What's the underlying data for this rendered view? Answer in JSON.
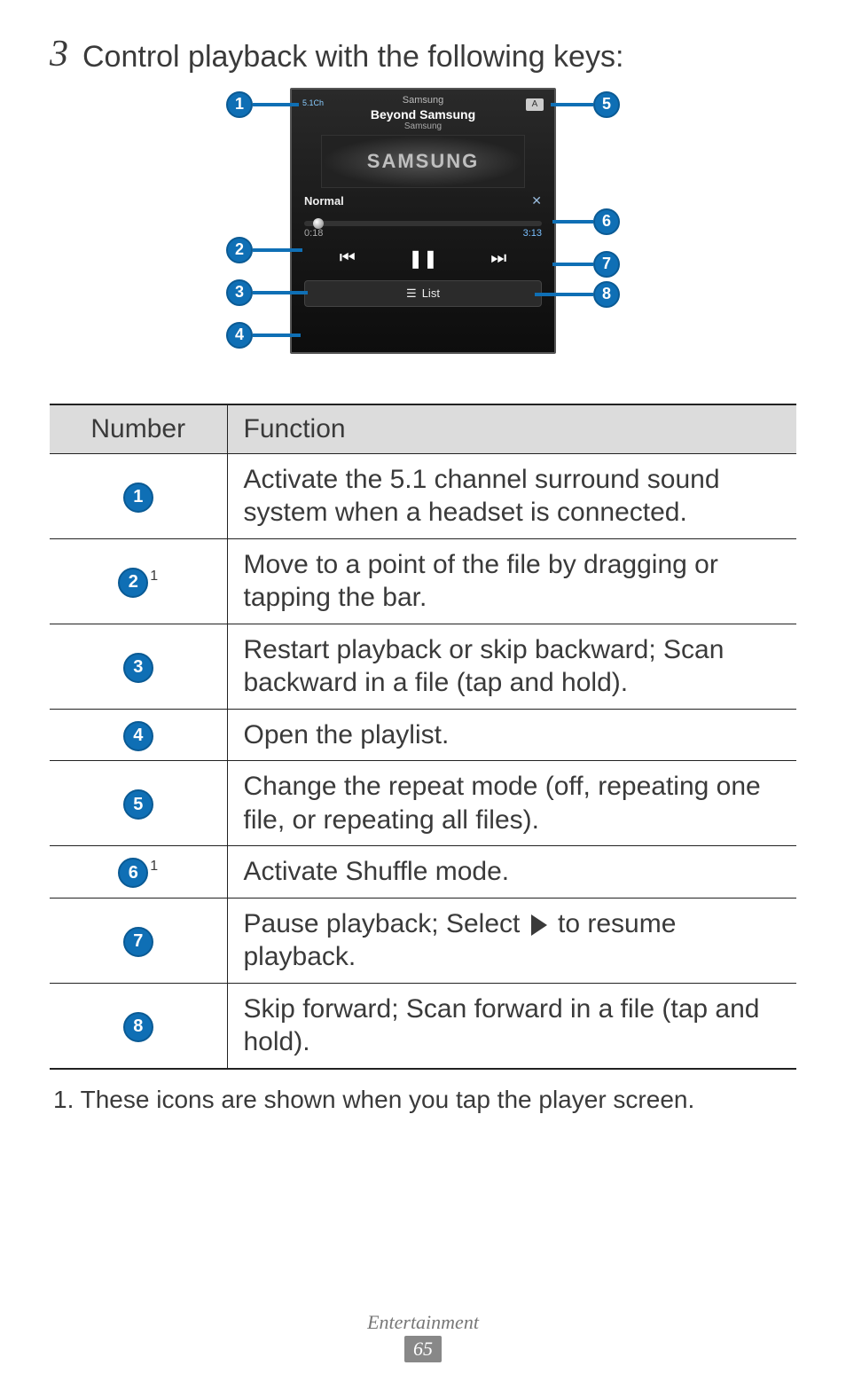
{
  "step": {
    "number": "3",
    "text": "Control playback with the following keys:"
  },
  "phone": {
    "meta_top": "Samsung",
    "title": "Beyond Samsung",
    "meta_sub": "Samsung",
    "art_text": "SAMSUNG",
    "eq_label": "Normal",
    "shuffle_glyph": "✕",
    "elapsed": "0:18",
    "duration": "3:13",
    "prev_glyph": "⏮",
    "pause_glyph": "❚❚",
    "next_glyph": "⏭",
    "list_label": "List",
    "list_icon": "☰",
    "badge51": "5.1Ch",
    "repeat_glyph": "A"
  },
  "callouts": {
    "c1": "1",
    "c2": "2",
    "c3": "3",
    "c4": "4",
    "c5": "5",
    "c6": "6",
    "c7": "7",
    "c8": "8"
  },
  "table": {
    "headers": {
      "num": "Number",
      "func": "Function"
    },
    "rows": [
      {
        "num": "1",
        "sup": "",
        "func": "Activate the 5.1 channel surround sound system when a headset is connected."
      },
      {
        "num": "2",
        "sup": "1",
        "func": "Move to a point of the file by dragging or tapping the bar."
      },
      {
        "num": "3",
        "sup": "",
        "func": "Restart playback or skip backward; Scan backward in a file (tap and hold)."
      },
      {
        "num": "4",
        "sup": "",
        "func": "Open the playlist."
      },
      {
        "num": "5",
        "sup": "",
        "func": "Change the repeat mode (off, repeating one file, or repeating all files)."
      },
      {
        "num": "6",
        "sup": "1",
        "func": "Activate Shuffle mode."
      },
      {
        "num": "7",
        "sup": "",
        "func_pre": "Pause playback; Select ",
        "func_post": " to resume playback.",
        "has_play": true
      },
      {
        "num": "8",
        "sup": "",
        "func": "Skip forward; Scan forward in a file (tap and hold)."
      }
    ]
  },
  "footnote": "1.  These icons are shown when you tap the player screen.",
  "footer": {
    "section": "Entertainment",
    "page": "65"
  }
}
